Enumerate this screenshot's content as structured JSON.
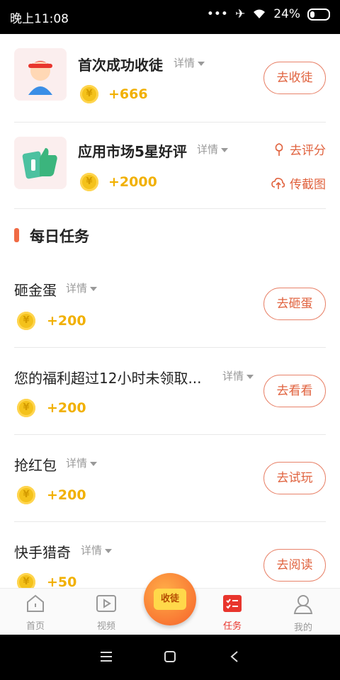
{
  "status_bar": {
    "time": "晚上11:08",
    "battery": "24%"
  },
  "tasks_top": [
    {
      "title": "首次成功收徒",
      "detail": "详情",
      "reward": "+666",
      "action": "去收徒"
    },
    {
      "title": "应用市场5星好评",
      "detail": "详情",
      "reward": "+2000",
      "action_rate": "去评分",
      "action_upload": "传截图"
    }
  ],
  "section": {
    "title": "每日任务"
  },
  "daily_tasks": [
    {
      "title": "砸金蛋",
      "detail": "详情",
      "reward": "+200",
      "action": "去砸蛋"
    },
    {
      "title": "您的福利超过12小时未领取...",
      "detail": "详情",
      "reward": "+200",
      "action": "去看看"
    },
    {
      "title": "抢红包",
      "detail": "详情",
      "reward": "+200",
      "action": "去试玩"
    },
    {
      "title": "快手猎奇",
      "detail": "详情",
      "reward": "+50",
      "action": "去阅读"
    }
  ],
  "coin_glyph": "¥",
  "tabbar": {
    "home": "首页",
    "video": "视频",
    "fab": "收徒",
    "task": "任务",
    "mine": "我的"
  },
  "colors": {
    "accent": "#e0623e",
    "gold": "#f1b000",
    "active_tab": "#e8352d"
  }
}
